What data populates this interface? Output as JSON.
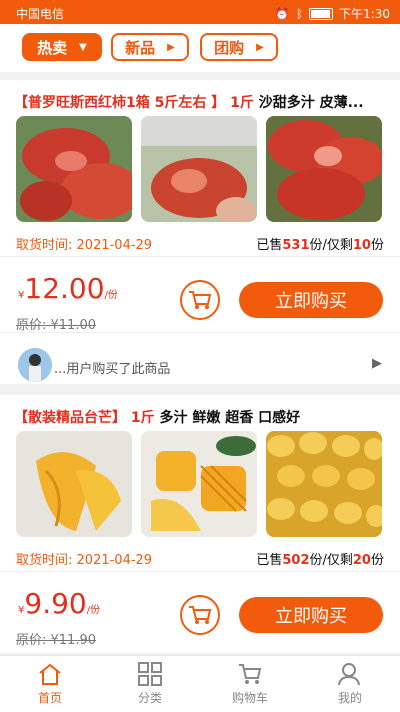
{
  "status_bar": {
    "carrier": "中国电信",
    "time": "下午1:30",
    "battery_level": 0.85
  },
  "tabs": [
    {
      "label": "热卖",
      "active": true
    },
    {
      "label": "新品",
      "active": false
    },
    {
      "label": "团购",
      "active": false
    }
  ],
  "products": [
    {
      "name": "【普罗旺斯西红柿1箱 5斤左右 】",
      "spec": "1斤",
      "desc": "沙甜多汁 皮薄...",
      "image_icons": [
        "tomato-photo-1",
        "tomato-photo-2",
        "tomato-photo-3"
      ],
      "pickup_label": "取货时间:",
      "pickup_date": "2021-04-29",
      "sold_prefix": "已售",
      "sold_count": "531",
      "sold_unit": "份/仅剩",
      "remaining": "10",
      "remaining_unit": "份",
      "currency": "¥",
      "price": "12.00",
      "price_unit": "/份",
      "original_price": "原价: ¥11.00",
      "buy_label": "立即购买",
      "buyer_note": "...用户购买了此商品"
    },
    {
      "name": "【散装精品台芒】",
      "spec": "1斤",
      "desc": "多汁 鲜嫩 超香 口感好",
      "image_icons": [
        "mango-photo-1",
        "mango-photo-2",
        "mango-photo-3"
      ],
      "pickup_label": "取货时间:",
      "pickup_date": "2021-04-29",
      "sold_prefix": "已售",
      "sold_count": "502",
      "sold_unit": "份/仅剩",
      "remaining": "20",
      "remaining_unit": "份",
      "currency": "¥",
      "price": "9.90",
      "price_unit": "/份",
      "original_price": "原价: ¥11.90",
      "buy_label": "立即购买"
    }
  ],
  "bottom_nav": [
    {
      "label": "首页",
      "icon": "home-icon",
      "active": true
    },
    {
      "label": "分类",
      "icon": "category-grid-icon",
      "active": false
    },
    {
      "label": "购物车",
      "icon": "cart-icon",
      "active": false
    },
    {
      "label": "我的",
      "icon": "profile-icon",
      "active": false
    }
  ],
  "colors": {
    "accent": "#f25a0c",
    "price": "#e3301e"
  }
}
